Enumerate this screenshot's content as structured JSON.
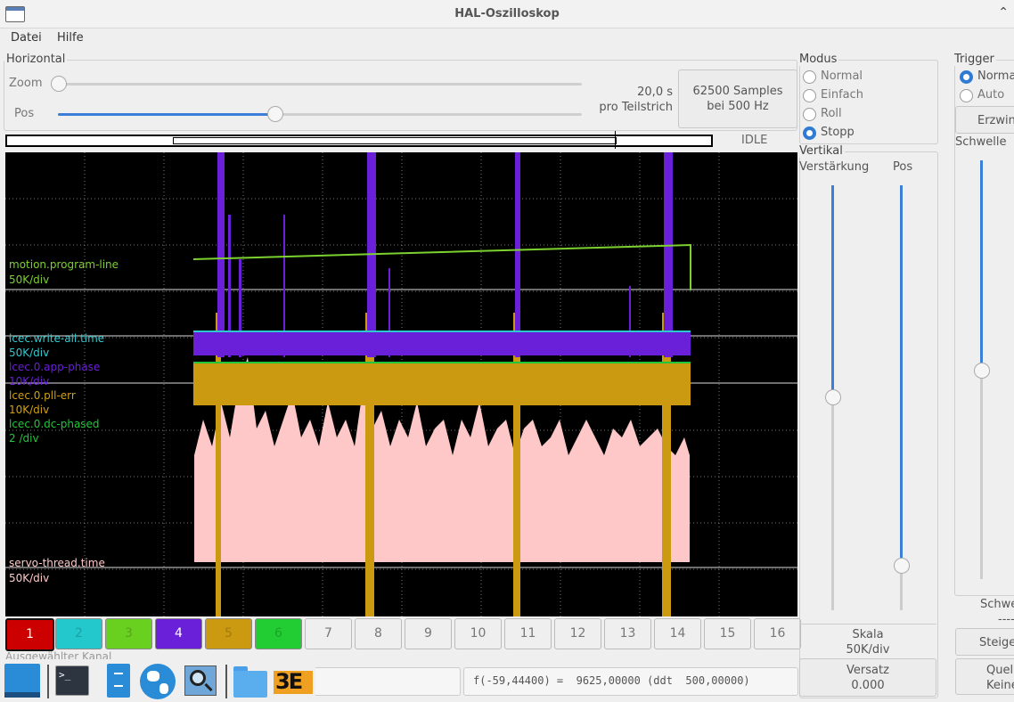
{
  "window": {
    "title": "HAL-Oszilloskop"
  },
  "menu": {
    "file": "Datei",
    "help": "Hilfe"
  },
  "horizontal": {
    "title": "Horizontal",
    "zoom_label": "Zoom",
    "pos_label": "Pos",
    "time_value": "20,0 s",
    "time_unit": "pro Teilstrich",
    "samples_line1": "62500 Samples",
    "samples_line2": "bei 500 Hz",
    "status": "IDLE"
  },
  "mode": {
    "title": "Modus",
    "options": [
      "Normal",
      "Einfach",
      "Roll",
      "Stopp"
    ],
    "selected": "Stopp"
  },
  "trigger": {
    "title": "Trigger",
    "options": [
      "Normal",
      "Auto"
    ],
    "selected": "Normal",
    "force_label": "Erzwingen",
    "threshold_label": "Schwelle",
    "threshold_bottom_label": "Schwelle",
    "threshold_value": "----",
    "slope_label": "Steigend",
    "source_line1": "Quelle",
    "source_line2": "Keine"
  },
  "vertical": {
    "title": "Vertikal",
    "gain_label": "Verstärkung",
    "pos_label": "Pos",
    "scale_label": "Skala",
    "scale_value": "50K/div",
    "offset_label": "Versatz",
    "offset_value": "0.000"
  },
  "traces": [
    {
      "name": "motion.program-line",
      "scale": "50K/div",
      "color": "#7cd02f"
    },
    {
      "name": "lcec.write-all.time",
      "scale": "50K/div",
      "color": "#2ec9cf"
    },
    {
      "name": "lcec.0.app-phase",
      "scale": "10K/div",
      "color": "#6a1fd8"
    },
    {
      "name": "lcec.0.pll-err",
      "scale": "10K/div",
      "color": "#d0a010"
    },
    {
      "name": "lcec.0.dc-phased",
      "scale": "2 /div",
      "color": "#22c63a"
    },
    {
      "name": "servo-thread.time",
      "scale": "50K/div",
      "color": "#ffc8c8"
    }
  ],
  "channels": [
    {
      "label": "1",
      "color": "#cc0000"
    },
    {
      "label": "2",
      "color": "#22c8cc"
    },
    {
      "label": "3",
      "color": "#6ad020"
    },
    {
      "label": "4",
      "color": "#6a1fd8"
    },
    {
      "label": "5",
      "color": "#cc9a10"
    },
    {
      "label": "6",
      "color": "#22cc33"
    },
    {
      "label": "7"
    },
    {
      "label": "8"
    },
    {
      "label": "9"
    },
    {
      "label": "10"
    },
    {
      "label": "11"
    },
    {
      "label": "12"
    },
    {
      "label": "13"
    },
    {
      "label": "14"
    },
    {
      "label": "15"
    },
    {
      "label": "16"
    }
  ],
  "footer": {
    "selected_channel_label": "Ausgewählter Kanal",
    "readout": "f(-59,44400) =  9625,00000 (ddt  500,00000)"
  },
  "taskbar": {
    "icons": [
      "desktop-icon",
      "terminal-icon",
      "file-cabinet-icon",
      "browser-globe-icon",
      "search-icon",
      "folder-icon",
      "app-logo-icon"
    ]
  }
}
